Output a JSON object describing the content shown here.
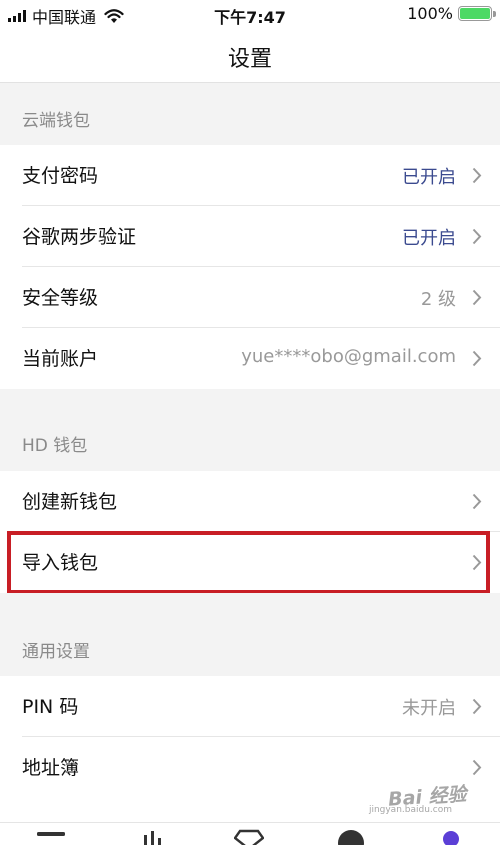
{
  "status_bar": {
    "carrier": "中国联通",
    "time": "下午7:47",
    "battery": "100%",
    "battery_color": "#4cd964"
  },
  "nav": {
    "title": "设置"
  },
  "sections": {
    "cloud": {
      "header": "云端钱包",
      "rows": [
        {
          "label": "支付密码",
          "value": "已开启"
        },
        {
          "label": "谷歌两步验证",
          "value": "已开启"
        },
        {
          "label": "安全等级",
          "value": "2 级"
        },
        {
          "label": "当前账户",
          "value": "yue****obo@gmail.com"
        }
      ]
    },
    "hd": {
      "header": "HD 钱包",
      "rows": [
        {
          "label": "创建新钱包"
        },
        {
          "label": "导入钱包"
        }
      ]
    },
    "general": {
      "header": "通用设置",
      "rows": [
        {
          "label": "PIN 码",
          "value": "未开启"
        },
        {
          "label": "地址簿"
        }
      ]
    }
  },
  "tab_bar": {
    "icons": [
      "wallet-icon",
      "chart-icon",
      "diamond-icon",
      "send-icon",
      "profile-icon"
    ],
    "active_color": "#5b3fd6"
  },
  "colors": {
    "enabled_value": "#3b4a8f",
    "highlight": "#c81e25"
  },
  "watermark": {
    "text": "Bai 经验",
    "sub": "jingyan.baidu.com"
  }
}
